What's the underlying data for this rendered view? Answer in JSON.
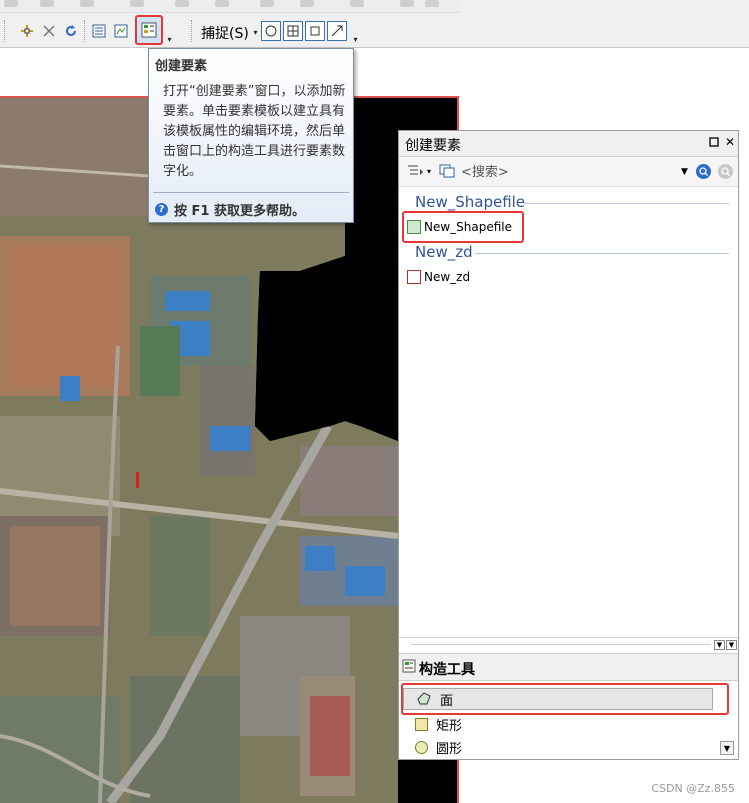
{
  "toolbar": {
    "snap_label": "捕捉(S)",
    "snap_dropdown_chevron": "▾"
  },
  "tooltip": {
    "title": "创建要素",
    "body": "打开“创建要素”窗口，以添加新要素。单击要素模板以建立具有该模板属性的编辑环境，然后单击窗口上的构造工具进行要素数字化。",
    "help": "按 F1 获取更多帮助。"
  },
  "panel": {
    "title": "创建要素",
    "search_placeholder": "<搜索>",
    "groups": [
      {
        "name": "New_Shapefile",
        "item": "New_Shapefile",
        "fill": "#cfe8cf",
        "border": "#4a8a4a"
      },
      {
        "name": "New_zd",
        "item": "New_zd",
        "fill": "#ffffff",
        "border": "#b03030"
      }
    ],
    "tools_title": "构造工具",
    "tools": [
      "面",
      "矩形",
      "圆形"
    ]
  },
  "watermark": "CSDN @Zz.855",
  "colors": {
    "highlight": "#e53935",
    "accent": "#2f5597",
    "map_background": "#000000"
  }
}
